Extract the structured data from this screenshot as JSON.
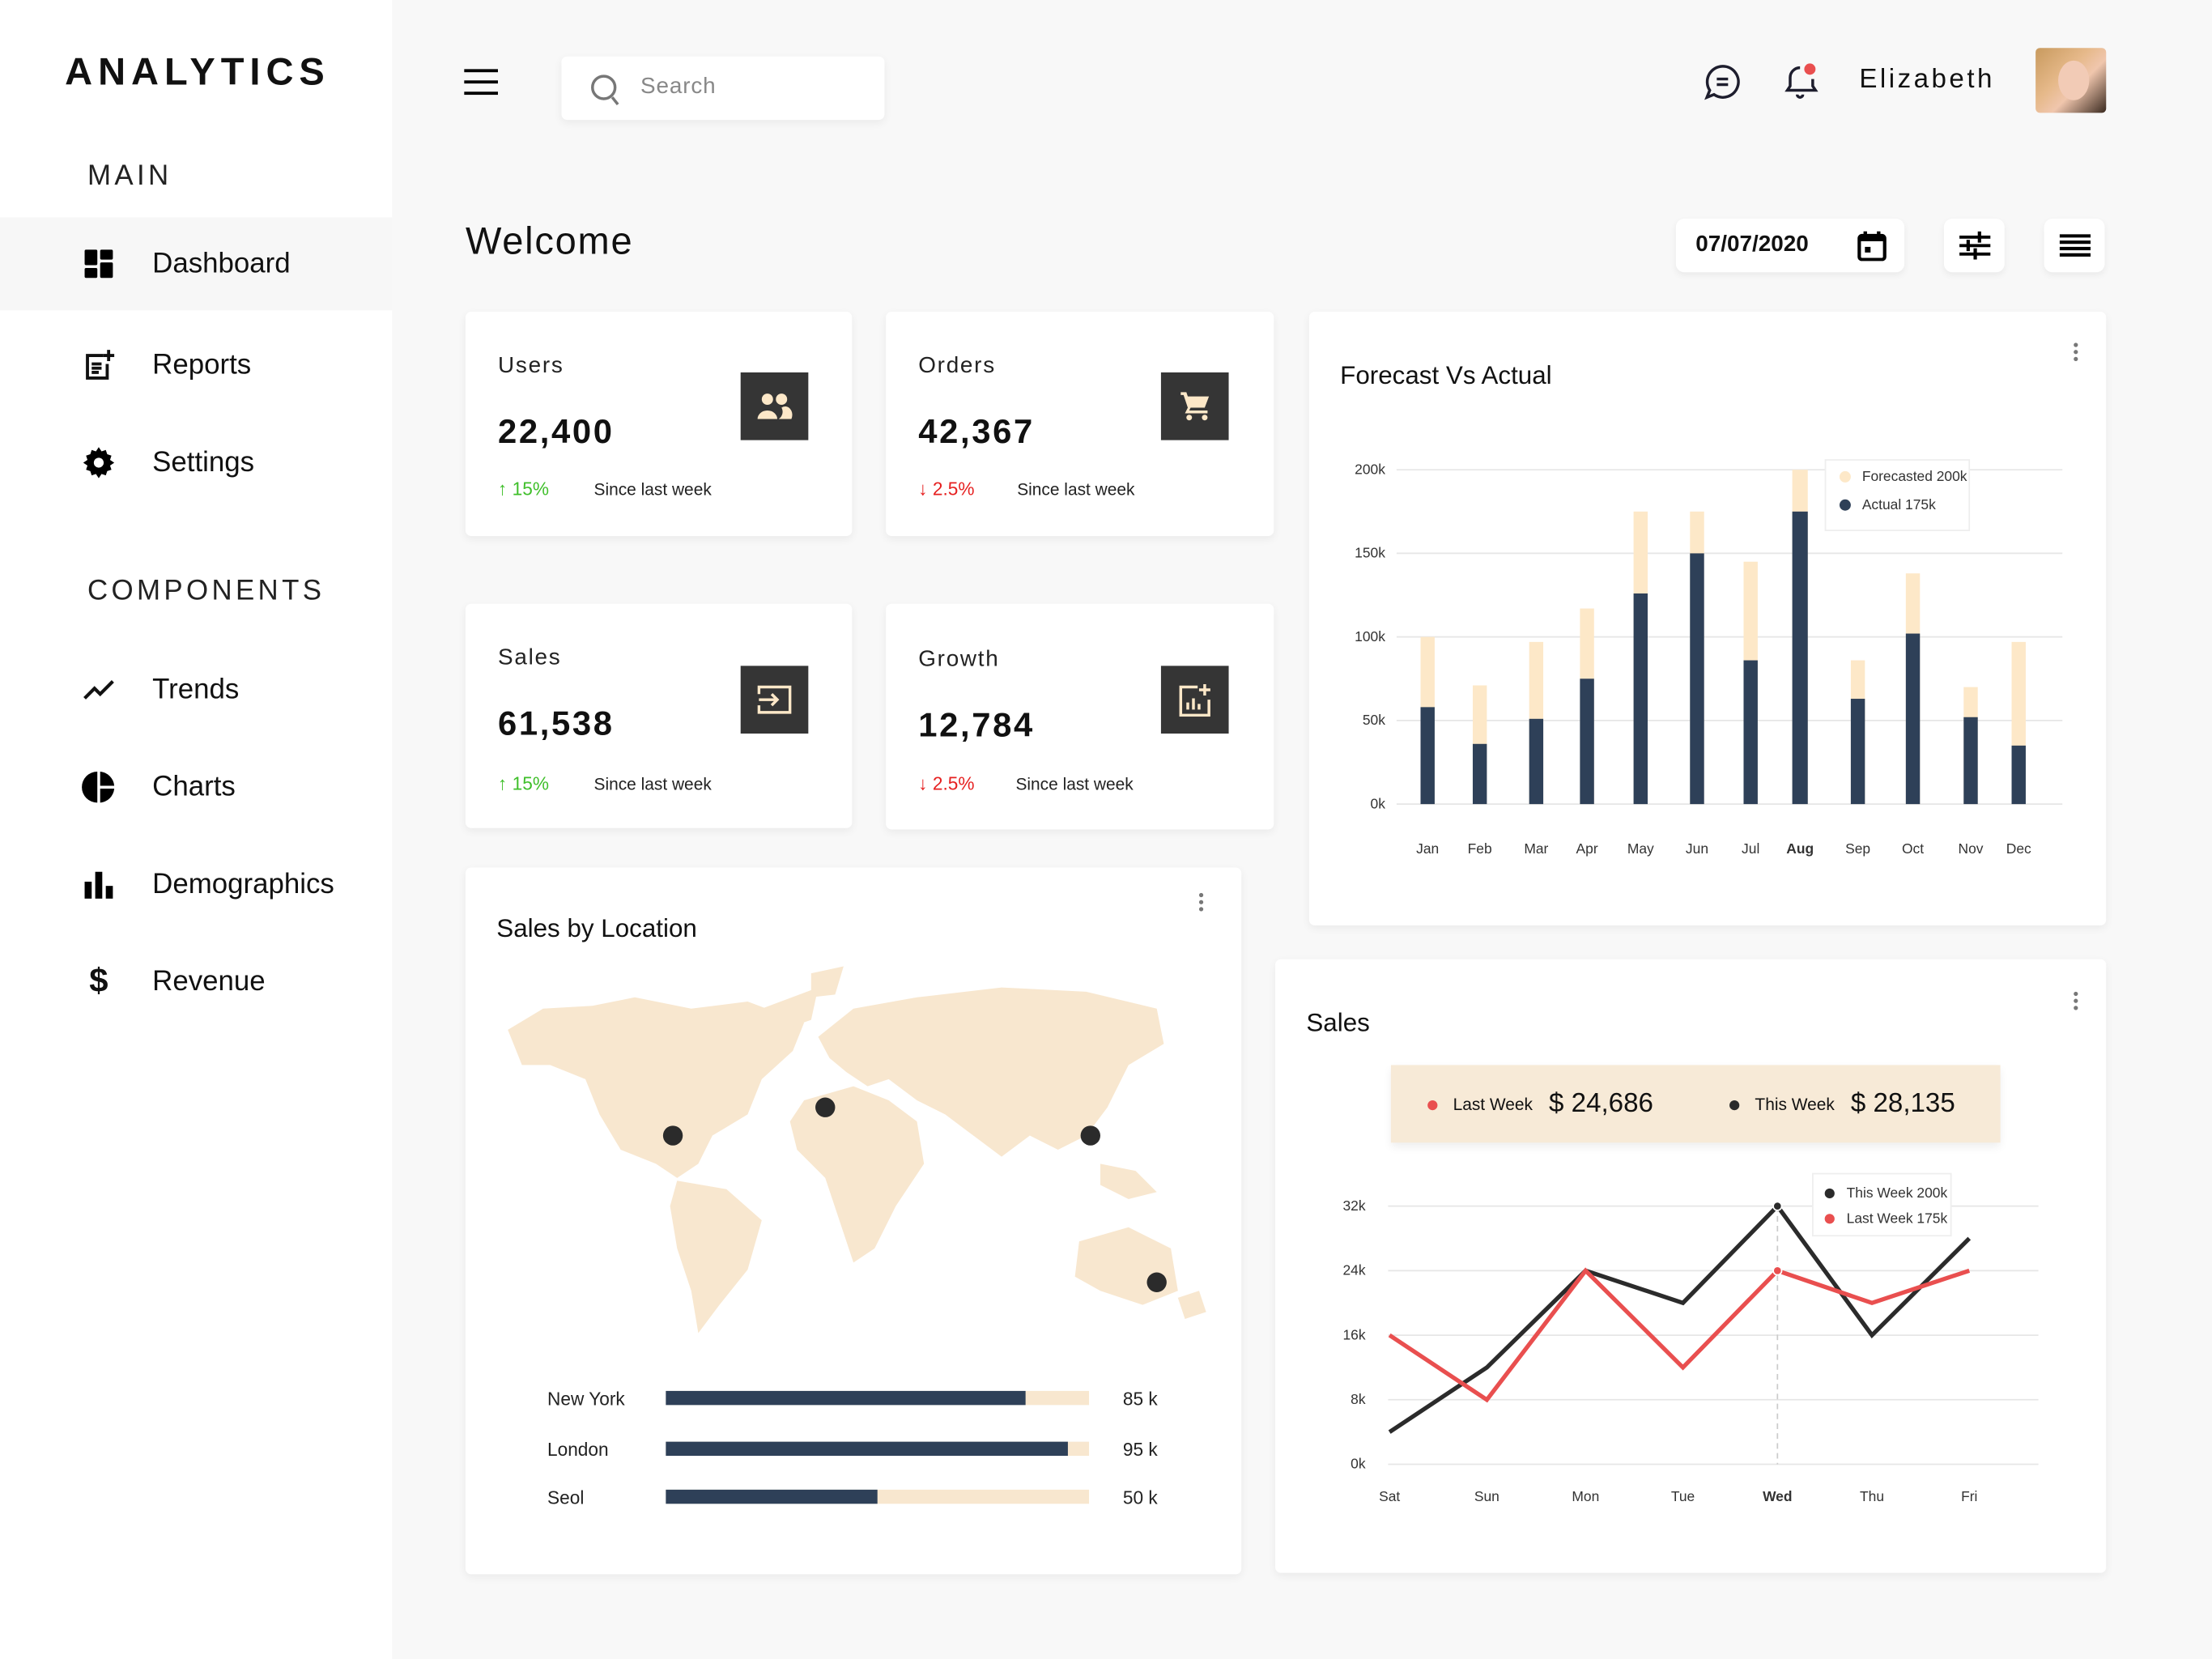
{
  "app": {
    "title": "ANALYTICS"
  },
  "sidebar": {
    "main_label": "MAIN",
    "main_items": [
      {
        "label": "Dashboard",
        "icon": "dashboard-icon",
        "active": true
      },
      {
        "label": "Reports",
        "icon": "report-add-icon"
      },
      {
        "label": "Settings",
        "icon": "gear-icon"
      }
    ],
    "components_label": "COMPONENTS",
    "component_items": [
      {
        "label": "Trends",
        "icon": "trend-line-icon"
      },
      {
        "label": "Charts",
        "icon": "pie-chart-icon"
      },
      {
        "label": "Demographics",
        "icon": "bar-chart-icon"
      },
      {
        "label": "Revenue",
        "icon": "dollar-icon"
      }
    ]
  },
  "header": {
    "search_placeholder": "Search",
    "user_name": "Elizabeth",
    "notification_dot_color": "#e94f4f"
  },
  "page": {
    "title": "Welcome",
    "date": "07/07/2020"
  },
  "stats": [
    {
      "title": "Users",
      "value": "22,400",
      "change": "15%",
      "direction": "up",
      "since": "Since last week",
      "icon": "users-icon"
    },
    {
      "title": "Orders",
      "value": "42,367",
      "change": "2.5%",
      "direction": "down",
      "since": "Since last week",
      "icon": "cart-icon"
    },
    {
      "title": "Sales",
      "value": "61,538",
      "change": "15%",
      "direction": "up",
      "since": "Since last week",
      "icon": "login-icon"
    },
    {
      "title": "Growth",
      "value": "12,784",
      "change": "2.5%",
      "direction": "down",
      "since": "Since last week",
      "icon": "chart-add-icon"
    }
  ],
  "colors": {
    "actual": "#2e4058",
    "forecast": "#fde8c8",
    "this_week": "#2b2b2b",
    "last_week": "#e94f4f",
    "map": "#f8e7cf",
    "accent_dark": "#353535"
  },
  "location": {
    "title": "Sales by Location",
    "rows": [
      {
        "city": "New York",
        "value": "85 k",
        "fraction": 0.85
      },
      {
        "city": "London",
        "value": "95 k",
        "fraction": 0.95
      },
      {
        "city": "Seol",
        "value": "50 k",
        "fraction": 0.5
      }
    ]
  },
  "chart_data": [
    {
      "type": "bar",
      "title": "Forecast Vs Actual",
      "stacked": "overlay",
      "categories": [
        "Jan",
        "Feb",
        "Mar",
        "Apr",
        "May",
        "Jun",
        "Jul",
        "Aug",
        "Sep",
        "Oct",
        "Nov",
        "Dec"
      ],
      "highlight": "Aug",
      "yticks": [
        "0k",
        "50k",
        "100k",
        "150k",
        "200k"
      ],
      "ylim": [
        0,
        200
      ],
      "series": [
        {
          "name": "Forecasted",
          "values": [
            100,
            71,
            97,
            117,
            175,
            175,
            145,
            200,
            86,
            138,
            70,
            97
          ]
        },
        {
          "name": "Actual",
          "values": [
            58,
            36,
            51,
            75,
            126,
            150,
            86,
            175,
            63,
            102,
            52,
            35
          ]
        }
      ],
      "tooltip": {
        "forecast": "Forecasted 200k",
        "actual": "Actual 175k"
      },
      "grid": true
    },
    {
      "type": "line",
      "title": "Sales",
      "summary": {
        "last_week_label": "Last Week",
        "last_week_value": "$ 24,686",
        "this_week_label": "This Week",
        "this_week_value": "$ 28,135"
      },
      "categories": [
        "Sat",
        "Sun",
        "Mon",
        "Tue",
        "Wed",
        "Thu",
        "Fri"
      ],
      "highlight": "Wed",
      "yticks": [
        "0k",
        "8k",
        "16k",
        "24k",
        "32k"
      ],
      "ylim": [
        0,
        32
      ],
      "series": [
        {
          "name": "This Week",
          "values": [
            4,
            12,
            24,
            20,
            32,
            16,
            28
          ]
        },
        {
          "name": "Last Week",
          "values": [
            16,
            8,
            24,
            12,
            24,
            20,
            24
          ]
        }
      ],
      "tooltip": {
        "this_week": "This Week  200k",
        "last_week": "Last Week  175k"
      },
      "grid": true
    }
  ]
}
